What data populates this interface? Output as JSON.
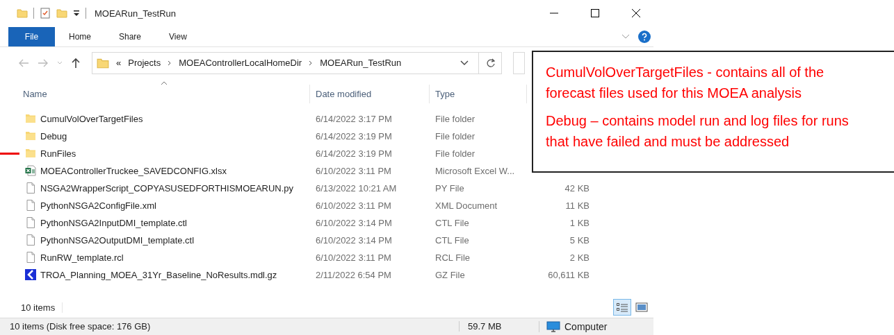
{
  "window": {
    "title": "MOEARun_TestRun"
  },
  "ribbon_tabs": [
    {
      "label": "File",
      "selected": true
    },
    {
      "label": "Home",
      "selected": false
    },
    {
      "label": "Share",
      "selected": false
    },
    {
      "label": "View",
      "selected": false
    }
  ],
  "address_bar": {
    "overflow": "«",
    "path": [
      "Projects",
      "MOEAControllerLocalHomeDir",
      "MOEARun_TestRun"
    ]
  },
  "columns": [
    "Name",
    "Date modified",
    "Type"
  ],
  "rows": [
    {
      "kind": "folder",
      "name": "CumulVolOverTargetFiles",
      "date": "6/14/2022 3:17 PM",
      "type": "File folder"
    },
    {
      "kind": "folder",
      "name": "Debug",
      "date": "6/14/2022 3:19 PM",
      "type": "File folder"
    },
    {
      "kind": "folder",
      "name": "RunFiles",
      "date": "6/14/2022 3:19 PM",
      "type": "File folder",
      "pointer": true
    },
    {
      "kind": "excel",
      "name": "MOEAControllerTruckee_SAVEDCONFIG.xlsx",
      "date": "6/10/2022 3:11 PM",
      "type": "Microsoft Excel W..."
    },
    {
      "kind": "file",
      "name": "NSGA2WrapperScript_COPYASUSEDFORTHISMOEARUN.py",
      "date": "6/13/2022 10:21 AM",
      "type": "PY File",
      "size": "42 KB"
    },
    {
      "kind": "file",
      "name": "PythonNSGA2ConfigFile.xml",
      "date": "6/10/2022 3:11 PM",
      "type": "XML Document",
      "size": "11 KB"
    },
    {
      "kind": "file",
      "name": "PythonNSGA2InputDMI_template.ctl",
      "date": "6/10/2022 3:14 PM",
      "type": "CTL File",
      "size": "1 KB"
    },
    {
      "kind": "file",
      "name": "PythonNSGA2OutputDMI_template.ctl",
      "date": "6/10/2022 3:14 PM",
      "type": "CTL File",
      "size": "5 KB"
    },
    {
      "kind": "file",
      "name": "RunRW_template.rcl",
      "date": "6/10/2022 3:11 PM",
      "type": "RCL File",
      "size": "2 KB"
    },
    {
      "kind": "app",
      "name": "TROA_Planning_MOEA_31Yr_Baseline_NoResults.mdl.gz",
      "date": "2/11/2022 6:54 PM",
      "type": "GZ File",
      "size": "60,611 KB"
    }
  ],
  "item_count": "10 items",
  "view_buttons": [
    {
      "kind": "details",
      "selected": true
    },
    {
      "kind": "tiles",
      "selected": false
    }
  ],
  "status_bar": {
    "summary": "10 items (Disk free space: 176 GB)",
    "size": "59.7 MB",
    "location": "Computer"
  },
  "callout": [
    "CumulVolOverTargetFiles - contains all of the forecast files used for this MOEA analysis",
    "Debug – contains model run and log files for runs that have failed and must be addressed"
  ]
}
